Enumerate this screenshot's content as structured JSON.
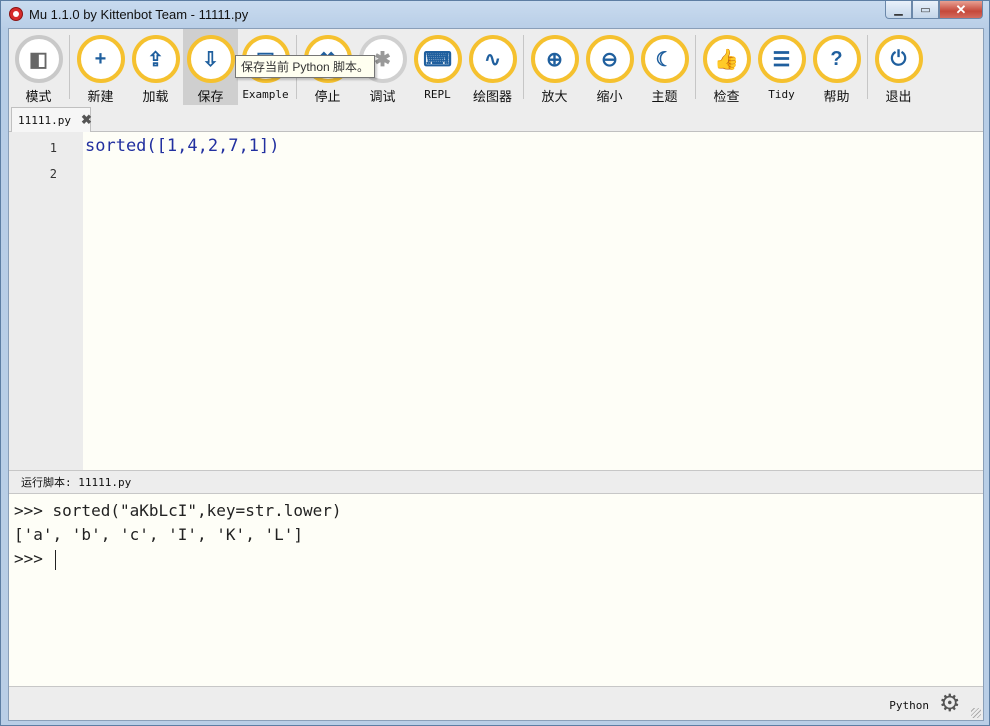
{
  "window": {
    "title": "Mu 1.1.0 by Kittenbot Team - 11111.py",
    "controls": {
      "minimize": "▁",
      "maximize": "▭",
      "close": "✕"
    }
  },
  "toolbar": {
    "buttons": [
      {
        "label": "模式",
        "icon": "mode-icon",
        "glyph": "◧"
      },
      {
        "label": "新建",
        "icon": "new-icon",
        "glyph": "+"
      },
      {
        "label": "加载",
        "icon": "load-icon",
        "glyph": "⇪"
      },
      {
        "label": "保存",
        "icon": "save-icon",
        "glyph": "⇩"
      },
      {
        "label": "Example",
        "icon": "example-icon",
        "glyph": "▤"
      },
      {
        "label": "停止",
        "icon": "stop-icon",
        "glyph": "✖"
      },
      {
        "label": "调试",
        "icon": "debug-icon",
        "glyph": "✱"
      },
      {
        "label": "REPL",
        "icon": "keyboard-icon",
        "glyph": "⌨"
      },
      {
        "label": "绘图器",
        "icon": "plotter-icon",
        "glyph": "∿"
      },
      {
        "label": "放大",
        "icon": "zoom-in-icon",
        "glyph": "⊕"
      },
      {
        "label": "缩小",
        "icon": "zoom-out-icon",
        "glyph": "⊖"
      },
      {
        "label": "主题",
        "icon": "theme-icon",
        "glyph": "☾"
      },
      {
        "label": "检查",
        "icon": "check-icon",
        "glyph": "👍"
      },
      {
        "label": "Tidy",
        "icon": "tidy-icon",
        "glyph": "☰"
      },
      {
        "label": "帮助",
        "icon": "help-icon",
        "glyph": "?"
      },
      {
        "label": "退出",
        "icon": "quit-icon",
        "glyph": "⏻"
      }
    ],
    "tooltip": "保存当前 Python 脚本。"
  },
  "tabs": [
    {
      "label": "11111.py",
      "close": "✖"
    }
  ],
  "editor": {
    "line_numbers": [
      "1",
      "2"
    ],
    "lines": [
      "sorted([1,4,2,7,1])",
      ""
    ]
  },
  "run_status": "运行脚本: 11111.py",
  "repl": {
    "lines": [
      ">>> sorted(\"aKbLcI\",key=str.lower)",
      "['a', 'b', 'c', 'I', 'K', 'L']",
      ">>> "
    ]
  },
  "statusbar": {
    "mode": "Python",
    "settings_icon": "⚙"
  }
}
